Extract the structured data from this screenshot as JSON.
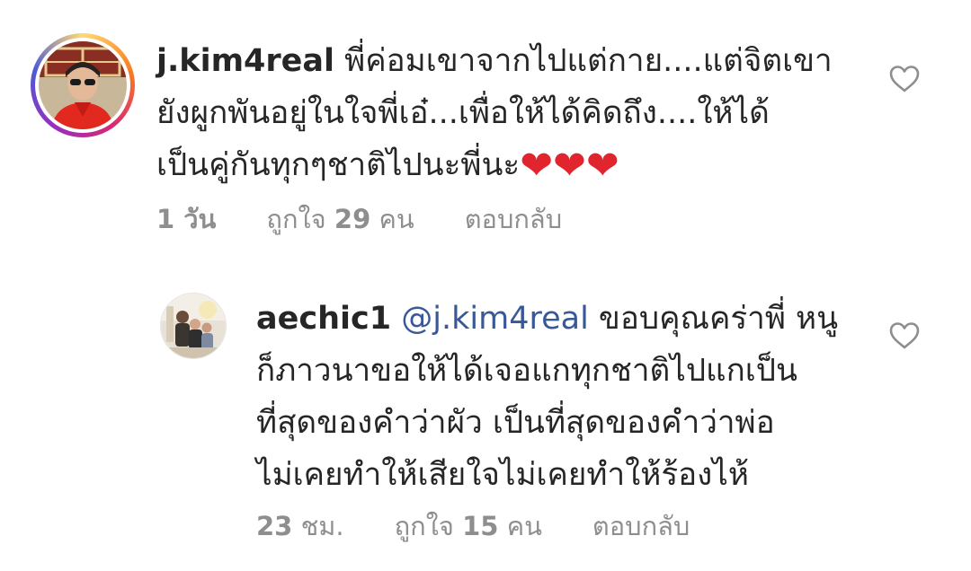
{
  "comments": [
    {
      "username": "j.kim4real",
      "lines": [
        "พี่ค่อมเขาจากไปแต่กาย....แต่จิตเขา",
        "ยังผูกพันอยู่ในใจพี่เอ๋...เพื่อให้ได้คิดถึง....ให้ได้",
        "เป็นคู่กันทุกๆชาติไปนะพี่นะ"
      ],
      "emoji": "❤❤❤",
      "time": "1 วัน",
      "likes_prefix": "ถูกใจ",
      "likes_count": "29",
      "likes_suffix": "คน",
      "reply_label": "ตอบกลับ"
    },
    {
      "username": "aechic1",
      "mention": "@j.kim4real",
      "first_line_text": " ขอบคุณคร่าพี่ หนู",
      "lines": [
        "ก็ภาวนาขอให้ได้เจอแกทุกชาติไปแกเป็น",
        "ที่สุดของคำว่าผัว เป็นที่สุดของคำว่าพ่อ",
        "ไม่เคยทำให้เสียใจไม่เคยทำให้ร้องไห้"
      ],
      "time_count": "23",
      "time_unit": "ชม.",
      "likes_prefix": "ถูกใจ",
      "likes_count": "15",
      "likes_suffix": "คน",
      "reply_label": "ตอบกลับ"
    }
  ],
  "colors": {
    "text": "#262626",
    "meta": "#8e8e8e",
    "mention": "#385898",
    "heart_emoji": "#e0252f"
  },
  "icons": {
    "like": "heart-outline-icon"
  }
}
